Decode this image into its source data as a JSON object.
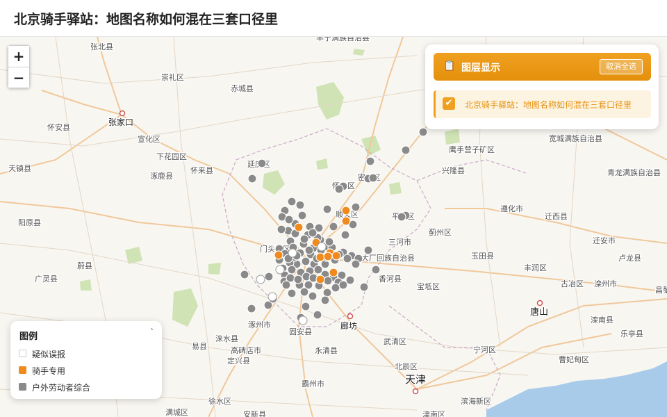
{
  "header": {
    "title": "北京骑手驿站：地图名称如何混在三套口径里"
  },
  "zoom": {
    "in_label": "+",
    "out_label": "−"
  },
  "layers": {
    "title": "图层显示",
    "icon": "clipboard-icon",
    "deselect_label": "取消全选",
    "items": [
      {
        "label": "北京骑手驿站：地图名称如何混在三套口径里",
        "checked": true
      }
    ]
  },
  "legend": {
    "title": "图例",
    "toggle": "˄",
    "items": [
      {
        "label": "疑似误报",
        "color": "#ffffff"
      },
      {
        "label": "骑手专用",
        "color": "#f08a1c"
      },
      {
        "label": "户外劳动者综合",
        "color": "#8a8a8a"
      }
    ]
  },
  "map": {
    "labels": [
      {
        "t": "丰宁满族自治县"
      },
      {
        "t": "张北县"
      },
      {
        "t": "崇礼区"
      },
      {
        "t": "赤城县"
      },
      {
        "t": "张家口"
      },
      {
        "t": "怀安县"
      },
      {
        "t": "宣化区"
      },
      {
        "t": "下花园区"
      },
      {
        "t": "天镇县"
      },
      {
        "t": "怀来县"
      },
      {
        "t": "涿鹿县"
      },
      {
        "t": "延庆区"
      },
      {
        "t": "怀柔区"
      },
      {
        "t": "密云区"
      },
      {
        "t": "顺义区"
      },
      {
        "t": "平谷区"
      },
      {
        "t": "阳原县"
      },
      {
        "t": "门头沟区"
      },
      {
        "t": "三河市"
      },
      {
        "t": "大厂回族自治县"
      },
      {
        "t": "蔚县"
      },
      {
        "t": "香河县"
      },
      {
        "t": "广灵县"
      },
      {
        "t": "涿州市"
      },
      {
        "t": "固安县"
      },
      {
        "t": "廊坊"
      },
      {
        "t": "易县"
      },
      {
        "t": "涞水县"
      },
      {
        "t": "高碑店市"
      },
      {
        "t": "定兴县"
      },
      {
        "t": "永清县"
      },
      {
        "t": "武清区"
      },
      {
        "t": "北辰区"
      },
      {
        "t": "天津"
      },
      {
        "t": "霸州市"
      },
      {
        "t": "徐水区"
      },
      {
        "t": "安新县"
      },
      {
        "t": "满城区"
      },
      {
        "t": "津南区"
      },
      {
        "t": "滨海新区"
      },
      {
        "t": "宁河区"
      },
      {
        "t": "宝坻区"
      },
      {
        "t": "蓟州区"
      },
      {
        "t": "玉田县"
      },
      {
        "t": "遵化市"
      },
      {
        "t": "兴隆县"
      },
      {
        "t": "鹰手营子矿区"
      },
      {
        "t": "宽城满族自治县"
      },
      {
        "t": "青龙满族自治县"
      },
      {
        "t": "迁西县"
      },
      {
        "t": "丰润区"
      },
      {
        "t": "唐山"
      },
      {
        "t": "迁安市"
      },
      {
        "t": "古冶区"
      },
      {
        "t": "滦州市"
      },
      {
        "t": "滦南县"
      },
      {
        "t": "卢龙县"
      },
      {
        "t": "乐亭县"
      },
      {
        "t": "曹妃甸区"
      },
      {
        "t": "昌黎县"
      }
    ],
    "points": [
      {
        "c": "gray"
      },
      {
        "c": "gray"
      },
      {
        "c": "gray"
      },
      {
        "c": "gray"
      },
      {
        "c": "gray"
      },
      {
        "c": "gray"
      },
      {
        "c": "gray"
      },
      {
        "c": "gray"
      },
      {
        "c": "gray"
      },
      {
        "c": "gray"
      },
      {
        "c": "gray"
      },
      {
        "c": "gray"
      },
      {
        "c": "gray"
      },
      {
        "c": "gray"
      },
      {
        "c": "gray"
      },
      {
        "c": "gray"
      },
      {
        "c": "gray"
      },
      {
        "c": "gray"
      },
      {
        "c": "gray"
      },
      {
        "c": "gray"
      },
      {
        "c": "gray"
      },
      {
        "c": "gray"
      },
      {
        "c": "gray"
      },
      {
        "c": "gray"
      },
      {
        "c": "gray"
      },
      {
        "c": "gray"
      },
      {
        "c": "gray"
      },
      {
        "c": "gray"
      },
      {
        "c": "gray"
      },
      {
        "c": "gray"
      },
      {
        "c": "gray"
      },
      {
        "c": "gray"
      },
      {
        "c": "gray"
      },
      {
        "c": "gray"
      },
      {
        "c": "gray"
      },
      {
        "c": "gray"
      },
      {
        "c": "gray"
      },
      {
        "c": "gray"
      },
      {
        "c": "gray"
      },
      {
        "c": "gray"
      },
      {
        "c": "gray"
      },
      {
        "c": "gray"
      },
      {
        "c": "gray"
      },
      {
        "c": "gray"
      },
      {
        "c": "gray"
      },
      {
        "c": "gray"
      },
      {
        "c": "gray"
      },
      {
        "c": "gray"
      },
      {
        "c": "gray"
      },
      {
        "c": "gray"
      },
      {
        "c": "gray"
      },
      {
        "c": "gray"
      },
      {
        "c": "gray"
      },
      {
        "c": "gray"
      },
      {
        "c": "gray"
      },
      {
        "c": "gray"
      },
      {
        "c": "gray"
      },
      {
        "c": "gray"
      },
      {
        "c": "gray"
      },
      {
        "c": "gray"
      },
      {
        "c": "gray"
      },
      {
        "c": "gray"
      },
      {
        "c": "gray"
      },
      {
        "c": "gray"
      },
      {
        "c": "gray"
      },
      {
        "c": "gray"
      },
      {
        "c": "gray"
      },
      {
        "c": "gray"
      },
      {
        "c": "gray"
      },
      {
        "c": "gray"
      },
      {
        "c": "gray"
      },
      {
        "c": "gray"
      },
      {
        "c": "gray"
      },
      {
        "c": "gray"
      },
      {
        "c": "gray"
      },
      {
        "c": "gray"
      },
      {
        "c": "gray"
      },
      {
        "c": "gray"
      },
      {
        "c": "gray"
      },
      {
        "c": "gray"
      },
      {
        "c": "gray"
      },
      {
        "c": "gray"
      },
      {
        "c": "gray"
      },
      {
        "c": "gray"
      },
      {
        "c": "gray"
      },
      {
        "c": "gray"
      },
      {
        "c": "gray"
      },
      {
        "c": "gray"
      },
      {
        "c": "gray"
      },
      {
        "c": "gray"
      },
      {
        "c": "gray"
      },
      {
        "c": "gray"
      },
      {
        "c": "gray"
      },
      {
        "c": "gray"
      },
      {
        "c": "gray"
      },
      {
        "c": "gray"
      },
      {
        "c": "gray"
      },
      {
        "c": "gray"
      },
      {
        "c": "gray"
      },
      {
        "c": "gray"
      },
      {
        "c": "gray"
      },
      {
        "c": "gray"
      },
      {
        "c": "gray"
      },
      {
        "c": "gray"
      },
      {
        "c": "orange"
      },
      {
        "c": "orange"
      },
      {
        "c": "orange"
      },
      {
        "c": "orange"
      },
      {
        "c": "orange"
      },
      {
        "c": "orange"
      },
      {
        "c": "orange"
      },
      {
        "c": "orange"
      },
      {
        "c": "orange"
      },
      {
        "c": "orange"
      },
      {
        "c": "orange"
      },
      {
        "c": "white"
      },
      {
        "c": "white"
      },
      {
        "c": "white"
      },
      {
        "c": "white"
      },
      {
        "c": "white"
      },
      {
        "c": "white"
      }
    ],
    "colors": {
      "gray": "#8a8a8a",
      "orange": "#f08a1c",
      "white": "#ffffff"
    }
  }
}
